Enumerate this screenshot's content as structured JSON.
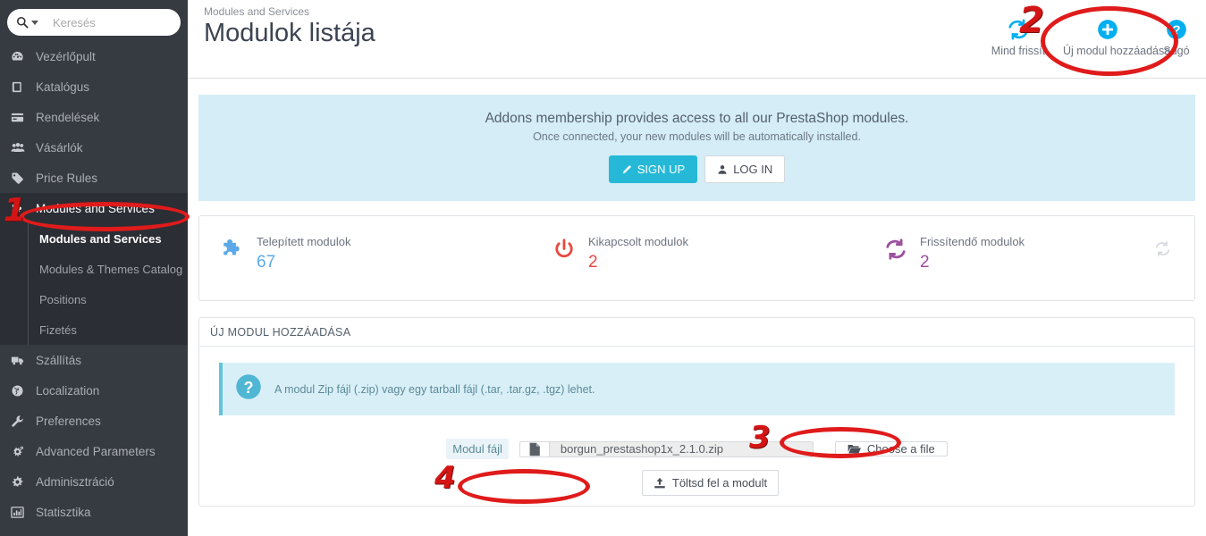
{
  "sidebar": {
    "search": {
      "placeholder": "Keresés",
      "value": "",
      "icon": "search-icon",
      "caret": "chevron-down-icon"
    },
    "items": [
      {
        "label": "Vezérlőpult",
        "icon": "dashboard-icon"
      },
      {
        "label": "Katalógus",
        "icon": "book-icon"
      },
      {
        "label": "Rendelések",
        "icon": "credit-card-icon"
      },
      {
        "label": "Vásárlók",
        "icon": "users-icon"
      },
      {
        "label": "Price Rules",
        "icon": "tag-icon"
      },
      {
        "label": "Modules and Services",
        "icon": "puzzle-icon",
        "active": true
      },
      {
        "label": "Szállítás",
        "icon": "truck-icon"
      },
      {
        "label": "Localization",
        "icon": "globe-icon"
      },
      {
        "label": "Preferences",
        "icon": "wrench-icon"
      },
      {
        "label": "Advanced Parameters",
        "icon": "gears-icon"
      },
      {
        "label": "Adminisztráció",
        "icon": "gear-icon"
      },
      {
        "label": "Statisztika",
        "icon": "bar-chart-icon"
      }
    ],
    "submenu": [
      {
        "label": "Modules and Services",
        "current": true
      },
      {
        "label": "Modules & Themes Catalog"
      },
      {
        "label": "Positions"
      },
      {
        "label": "Fizetés"
      }
    ]
  },
  "header": {
    "breadcrumb": "Modules and Services",
    "title": "Modulok listája",
    "actions": [
      {
        "label": "Mind frissít",
        "icon": "refresh-icon"
      },
      {
        "label": "Új modul hozzáadása",
        "icon": "plus-circle-icon"
      },
      {
        "label": "Súgó",
        "icon": "help-circle-icon"
      }
    ]
  },
  "addons_banner": {
    "title": "Addons membership provides access to all our PrestaShop modules.",
    "subtitle": "Once connected, your new modules will be automatically installed.",
    "signup_label": "SIGN UP",
    "signup_icon": "pencil-icon",
    "login_label": "LOG IN",
    "login_icon": "user-icon",
    "background": "#d4edf7",
    "signup_color": "#25b9d7"
  },
  "stats": [
    {
      "label": "Telepített modulok",
      "value": "67",
      "icon": "puzzle-icon",
      "color": "#5ba9e8"
    },
    {
      "label": "Kikapcsolt modulok",
      "value": "2",
      "icon": "power-icon",
      "color": "#e8493f"
    },
    {
      "label": "Frissítendő modulok",
      "value": "2",
      "icon": "sync-icon",
      "color": "#9b4f9e"
    }
  ],
  "stats_refresh_icon": "refresh-icon",
  "add_module_panel": {
    "heading": "ÚJ MODUL HOZZÁADÁSA",
    "alert": {
      "icon": "question-circle-icon",
      "text": "A modul Zip fájl (.zip) vagy egy tarball fájl (.tar, .tar.gz, .tgz) lehet."
    },
    "field_label": "Modul fájl",
    "file_icon": "file-icon",
    "file_name": "borgun_prestashop1x_2.1.0.zip",
    "choose_button": {
      "label": "Choose a file",
      "icon": "folder-open-icon"
    },
    "upload_button": {
      "label": "Töltsd fel a modult",
      "icon": "upload-icon"
    }
  },
  "annotations": {
    "color": "#e01b1b",
    "markers": [
      {
        "number": "1",
        "target": "sidebar-item-modules-and-services"
      },
      {
        "number": "2",
        "target": "header-action-add-new-module"
      },
      {
        "number": "3",
        "target": "choose-a-file-button"
      },
      {
        "number": "4",
        "target": "upload-module-button"
      }
    ]
  }
}
